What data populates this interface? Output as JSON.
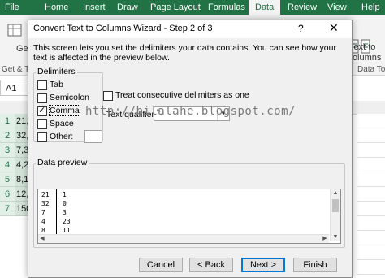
{
  "ribbon": {
    "tabs": [
      "File",
      "Home",
      "Insert",
      "Draw",
      "Page Layout",
      "Formulas",
      "Data",
      "Review",
      "View",
      "Help"
    ],
    "active_tab": "Data",
    "left_group_line1": "Get",
    "left_group_line2": "Get & T",
    "ttc_line1": "Text to",
    "ttc_line2": "Columns",
    "data_tools_group": "Data To",
    "accent_color": "#217346"
  },
  "namebox": {
    "value": "A1"
  },
  "grid": {
    "rows": [
      {
        "num": "1",
        "val": "21,"
      },
      {
        "num": "2",
        "val": "32,"
      },
      {
        "num": "3",
        "val": "7,3"
      },
      {
        "num": "4",
        "val": "4,2"
      },
      {
        "num": "5",
        "val": "8,1"
      },
      {
        "num": "6",
        "val": "12,"
      },
      {
        "num": "7",
        "val": "150"
      }
    ]
  },
  "dialog": {
    "title": "Convert Text to Columns Wizard - Step 2 of 3",
    "help": "?",
    "close": "✕",
    "description": "This screen lets you set the delimiters your data contains.  You can see how your text is affected in the preview below.",
    "delimiters_legend": "Delimiters",
    "tab_label": "Tab",
    "tab_checked": false,
    "semicolon_label": "Semicolon",
    "semicolon_checked": false,
    "comma_label": "Comma",
    "comma_checked": true,
    "space_label": "Space",
    "space_checked": false,
    "other_label": "Other:",
    "other_checked": false,
    "other_value": "",
    "consecutive_label": "Treat consecutive delimiters as one",
    "consecutive_checked": false,
    "qualifier_label": "Text qualifier:",
    "qualifier_value": "\"",
    "watermark": "http://bilalahe.blogspot.com/",
    "preview_legend": "Data preview",
    "preview_rows": [
      {
        "c1": "21",
        "c2": "1"
      },
      {
        "c1": "32",
        "c2": "0"
      },
      {
        "c1": "7",
        "c2": "3"
      },
      {
        "c1": "4",
        "c2": "23"
      },
      {
        "c1": "8",
        "c2": "11"
      }
    ],
    "buttons": {
      "cancel": "Cancel",
      "back": "< Back",
      "next": "Next >",
      "finish": "Finish"
    }
  }
}
